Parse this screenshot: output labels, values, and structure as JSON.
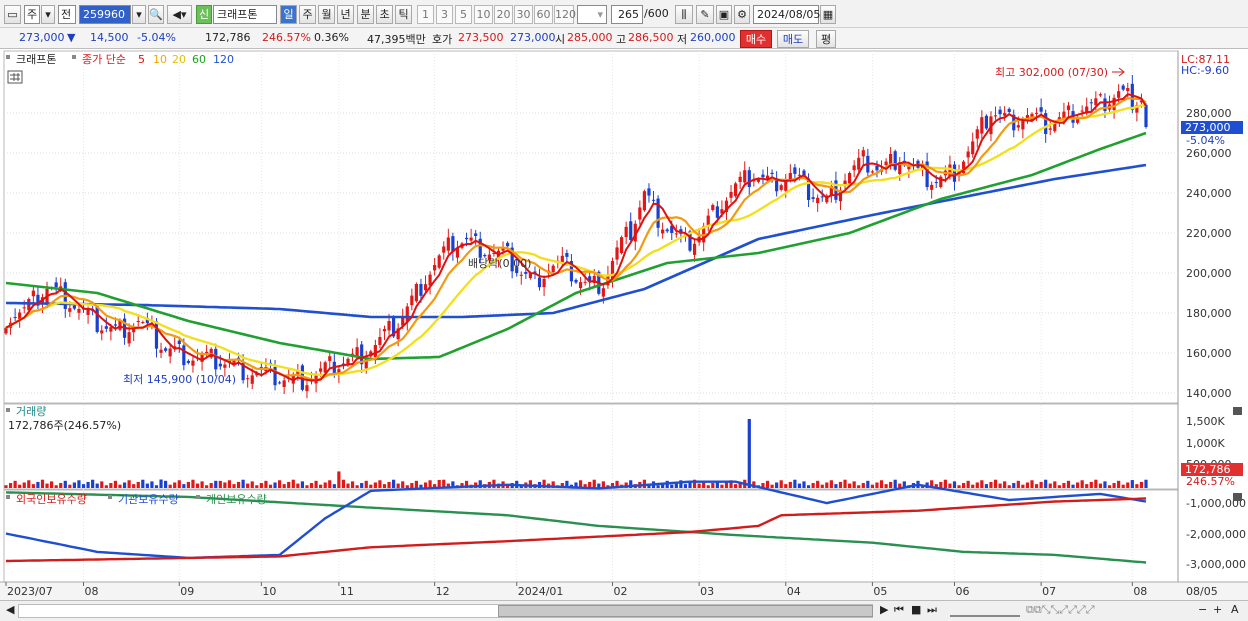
{
  "toolbar": {
    "market": "주",
    "period_mode": "전",
    "code": "259960",
    "badge": "신",
    "name": "크래프톤",
    "periods": [
      "일",
      "주",
      "월",
      "년",
      "분",
      "초",
      "틱"
    ],
    "intervals": [
      "1",
      "3",
      "5",
      "10",
      "20",
      "30",
      "60",
      "120"
    ],
    "count": "265",
    "count_total": "/600",
    "date": "2024/08/05"
  },
  "quote": {
    "price": "273,000",
    "change": "14,500",
    "change_rate": "-5.04%",
    "volume": "172,786",
    "volume_rate": "246.57%",
    "turnover": "0.36%",
    "amount": "47,395백만",
    "ask_label": "호가",
    "ask": "273,500",
    "bid": "273,000",
    "open_label": "시",
    "open": "285,000",
    "high_label": "고",
    "high": "286,500",
    "low_label": "저",
    "low": "260,000",
    "buy": "매수",
    "sell": "매도",
    "eval": "평"
  },
  "legend": {
    "name": "크래프톤",
    "price_label": "종가 단순",
    "ma": [
      "5",
      "10",
      "20",
      "60",
      "120"
    ],
    "ma_colors": [
      "#e01010",
      "#f0a800",
      "#e0c000",
      "#20a020",
      "#2050d0"
    ]
  },
  "price_axis": [
    "280,000",
    "260,000",
    "240,000",
    "220,000",
    "200,000",
    "180,000",
    "160,000",
    "140,000"
  ],
  "lc": "LC:87.11",
  "hc": "HC:-9.60",
  "last_price": "273,000",
  "last_rate": "-5.04%",
  "annotations": {
    "high": "최고 302,000 (07/30)",
    "low": "최저 145,900 (10/04)",
    "dividend": "배당락(0.00)"
  },
  "volume": {
    "title": "거래량",
    "info": "172,786주(246.57%)",
    "axis": [
      "1,500K",
      "1,000K",
      "500,000"
    ],
    "last": "172,786",
    "last_rate": "246.57%"
  },
  "holdings": {
    "series": [
      "외국인보유수량",
      "기관보유수량",
      "개인보유수량"
    ],
    "colors": [
      "#d21c1c",
      "#1f4fd0",
      "#2a9050"
    ],
    "axis": [
      "-1,000,000",
      "-2,000,000",
      "-3,000,000"
    ]
  },
  "xaxis": [
    "2023/07",
    "08",
    "09",
    "10",
    "11",
    "12",
    "2024/01",
    "02",
    "03",
    "04",
    "05",
    "06",
    "07",
    "08",
    "08/05"
  ],
  "chart_data": {
    "type": "candlestick",
    "title": "크래프톤",
    "close": [
      [
        0,
        178000
      ],
      [
        4,
        181000
      ],
      [
        9,
        193000
      ],
      [
        14,
        186000
      ],
      [
        19,
        176000
      ],
      [
        24,
        171000
      ],
      [
        29,
        176000
      ],
      [
        35,
        162000
      ],
      [
        41,
        158000
      ],
      [
        47,
        156000
      ],
      [
        53,
        151000
      ],
      [
        58,
        149000
      ],
      [
        63,
        146000
      ],
      [
        67,
        148000
      ],
      [
        71,
        153000
      ],
      [
        76,
        157000
      ],
      [
        81,
        164000
      ],
      [
        86,
        175000
      ],
      [
        89,
        186000
      ],
      [
        92,
        198000
      ],
      [
        95,
        207000
      ],
      [
        98,
        215000
      ],
      [
        101,
        216000
      ],
      [
        104,
        213000
      ],
      [
        107,
        210000
      ],
      [
        110,
        208000
      ],
      [
        113,
        200000
      ],
      [
        116,
        196000
      ],
      [
        119,
        203000
      ],
      [
        122,
        205000
      ],
      [
        125,
        198000
      ],
      [
        128,
        193000
      ],
      [
        131,
        196000
      ],
      [
        134,
        211000
      ],
      [
        137,
        221000
      ],
      [
        140,
        240000
      ],
      [
        143,
        228000
      ],
      [
        146,
        220000
      ],
      [
        149,
        214000
      ],
      [
        152,
        219000
      ],
      [
        156,
        233000
      ],
      [
        160,
        243000
      ],
      [
        164,
        249000
      ],
      [
        168,
        245000
      ],
      [
        172,
        250000
      ],
      [
        176,
        241000
      ],
      [
        180,
        236000
      ],
      [
        184,
        248000
      ],
      [
        188,
        256000
      ],
      [
        192,
        251000
      ],
      [
        196,
        259000
      ],
      [
        200,
        249000
      ],
      [
        204,
        246000
      ],
      [
        208,
        251000
      ],
      [
        212,
        264000
      ],
      [
        216,
        281000
      ],
      [
        220,
        276000
      ],
      [
        224,
        279000
      ],
      [
        228,
        274000
      ],
      [
        232,
        278000
      ],
      [
        236,
        283000
      ],
      [
        240,
        284000
      ],
      [
        244,
        290000
      ],
      [
        247,
        287000
      ],
      [
        249,
        288000
      ],
      [
        250,
        273000
      ]
    ],
    "ma60": [
      [
        0,
        195000
      ],
      [
        20,
        190000
      ],
      [
        40,
        176000
      ],
      [
        60,
        165000
      ],
      [
        80,
        157000
      ],
      [
        95,
        158000
      ],
      [
        110,
        172000
      ],
      [
        125,
        190000
      ],
      [
        145,
        205000
      ],
      [
        165,
        210000
      ],
      [
        185,
        220000
      ],
      [
        205,
        237000
      ],
      [
        225,
        249000
      ],
      [
        240,
        262000
      ],
      [
        250,
        270000
      ]
    ],
    "ma120": [
      [
        0,
        185000
      ],
      [
        30,
        184000
      ],
      [
        60,
        182000
      ],
      [
        80,
        178000
      ],
      [
        100,
        178000
      ],
      [
        120,
        180000
      ],
      [
        140,
        192000
      ],
      [
        165,
        217000
      ],
      [
        190,
        229000
      ],
      [
        210,
        238000
      ],
      [
        230,
        247000
      ],
      [
        250,
        254000
      ]
    ],
    "ymin": 140000,
    "ymax": 310000,
    "volume_k": [
      [
        34,
        185
      ],
      [
        47,
        155
      ],
      [
        73,
        360
      ],
      [
        95,
        175
      ],
      [
        163,
        615
      ],
      [
        247,
        172
      ]
    ],
    "foreign": [
      [
        0,
        -3.0
      ],
      [
        40,
        -2.9
      ],
      [
        60,
        -2.85
      ],
      [
        80,
        -2.55
      ],
      [
        110,
        -2.35
      ],
      [
        150,
        -2.05
      ],
      [
        165,
        -1.85
      ],
      [
        170,
        -1.5
      ],
      [
        200,
        -1.35
      ],
      [
        230,
        -1.05
      ],
      [
        250,
        -0.95
      ]
    ],
    "institution": [
      [
        0,
        -2.1
      ],
      [
        20,
        -2.7
      ],
      [
        40,
        -2.9
      ],
      [
        60,
        -2.8
      ],
      [
        70,
        -1.6
      ],
      [
        80,
        -0.7
      ],
      [
        110,
        -0.5
      ],
      [
        130,
        -0.62
      ],
      [
        150,
        -0.4
      ],
      [
        160,
        -0.4
      ],
      [
        180,
        -1.1
      ],
      [
        200,
        -0.5
      ],
      [
        220,
        -1.0
      ],
      [
        240,
        -0.8
      ],
      [
        250,
        -1.05
      ]
    ],
    "individual": [
      [
        0,
        -0.75
      ],
      [
        40,
        -0.9
      ],
      [
        80,
        -1.25
      ],
      [
        110,
        -1.5
      ],
      [
        130,
        -1.85
      ],
      [
        160,
        -2.15
      ],
      [
        190,
        -2.4
      ],
      [
        210,
        -2.7
      ],
      [
        230,
        -2.8
      ],
      [
        250,
        -3.05
      ]
    ]
  }
}
